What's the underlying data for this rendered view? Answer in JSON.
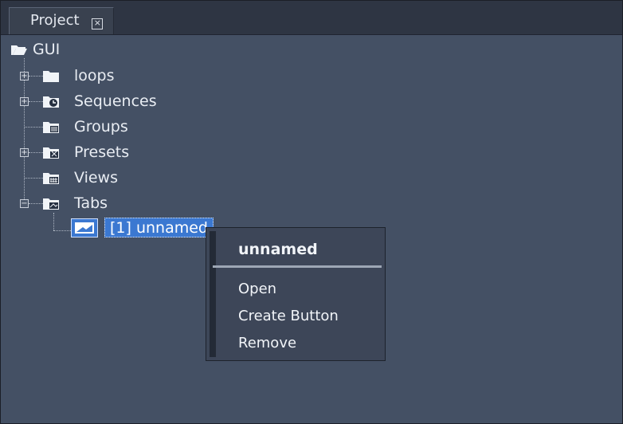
{
  "window": {
    "tab_title": "Project",
    "close_glyph": "×"
  },
  "tree": {
    "root_label": "GUI",
    "items": [
      {
        "label": "loops",
        "icon": "folder-icon",
        "expandable": true,
        "expanded": false
      },
      {
        "label": "Sequences",
        "icon": "sequence-folder-icon",
        "expandable": true,
        "expanded": false
      },
      {
        "label": "Groups",
        "icon": "groups-folder-icon",
        "expandable": false
      },
      {
        "label": "Presets",
        "icon": "presets-folder-icon",
        "expandable": true,
        "expanded": false
      },
      {
        "label": "Views",
        "icon": "views-folder-icon",
        "expandable": false
      },
      {
        "label": "Tabs",
        "icon": "tabs-folder-icon",
        "expandable": true,
        "expanded": true
      }
    ],
    "child": {
      "label": "[1] unnamed",
      "icon": "tab-icon"
    }
  },
  "context_menu": {
    "title": "unnamed",
    "items": [
      "Open",
      "Create Button",
      "Remove"
    ]
  }
}
